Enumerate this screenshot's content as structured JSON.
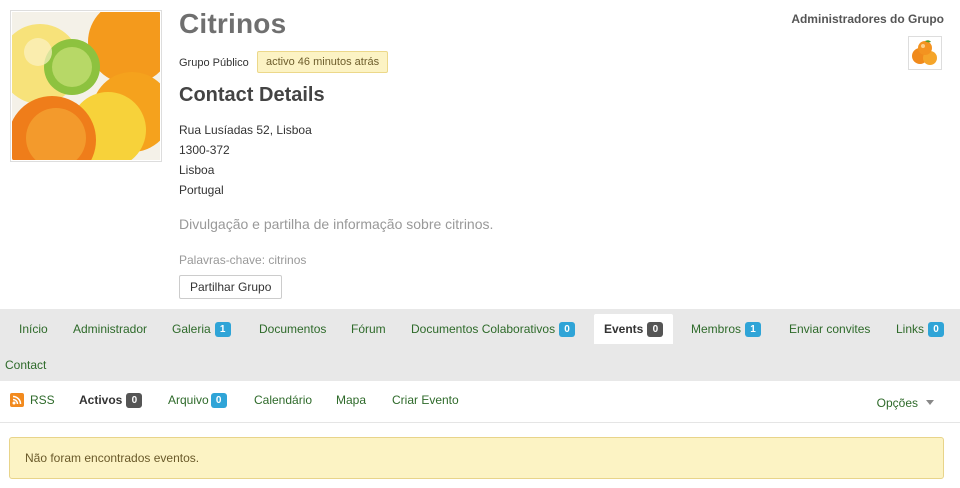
{
  "group": {
    "title": "Citrinos",
    "visibility": "Grupo Público",
    "activity": "activo 46 minutos atrás",
    "avatar_icon": "citrus-fruits-photo"
  },
  "contact": {
    "heading": "Contact Details",
    "street": "Rua Lusíadas 52, Lisboa",
    "postal_code": "1300-372",
    "city": "Lisboa",
    "country": "Portugal"
  },
  "description": "Divulgação e partilha de informação sobre citrinos.",
  "keywords": "Palavras-chave: citrinos",
  "share_button": "Partilhar Grupo",
  "admins": {
    "title": "Administradores do Grupo",
    "avatar_icon": "orange-fruit-avatar"
  },
  "tabs": [
    {
      "label": "Início"
    },
    {
      "label": "Administrador"
    },
    {
      "label": "Galeria",
      "badge": "1"
    },
    {
      "label": "Documentos"
    },
    {
      "label": "Fórum"
    },
    {
      "label": "Documentos Colaborativos",
      "badge": "0"
    },
    {
      "label": "Events",
      "badge": "0",
      "active": true
    },
    {
      "label": "Membros",
      "badge": "1"
    },
    {
      "label": "Enviar convites"
    },
    {
      "label": "Links",
      "badge": "0"
    },
    {
      "label": "Contact"
    }
  ],
  "subnav": {
    "rss": "RSS",
    "activos": "Activos",
    "activos_count": "0",
    "arquivo": "Arquivo",
    "arquivo_count": "0",
    "calendario": "Calendário",
    "mapa": "Mapa",
    "criar_evento": "Criar Evento",
    "opcoes": "Opções"
  },
  "empty_message": "Não foram encontrados eventos.",
  "colors": {
    "link_green": "#2e6a2a",
    "badge_blue": "#2fa4d7",
    "alert_yellow": "#fcf3c4"
  }
}
